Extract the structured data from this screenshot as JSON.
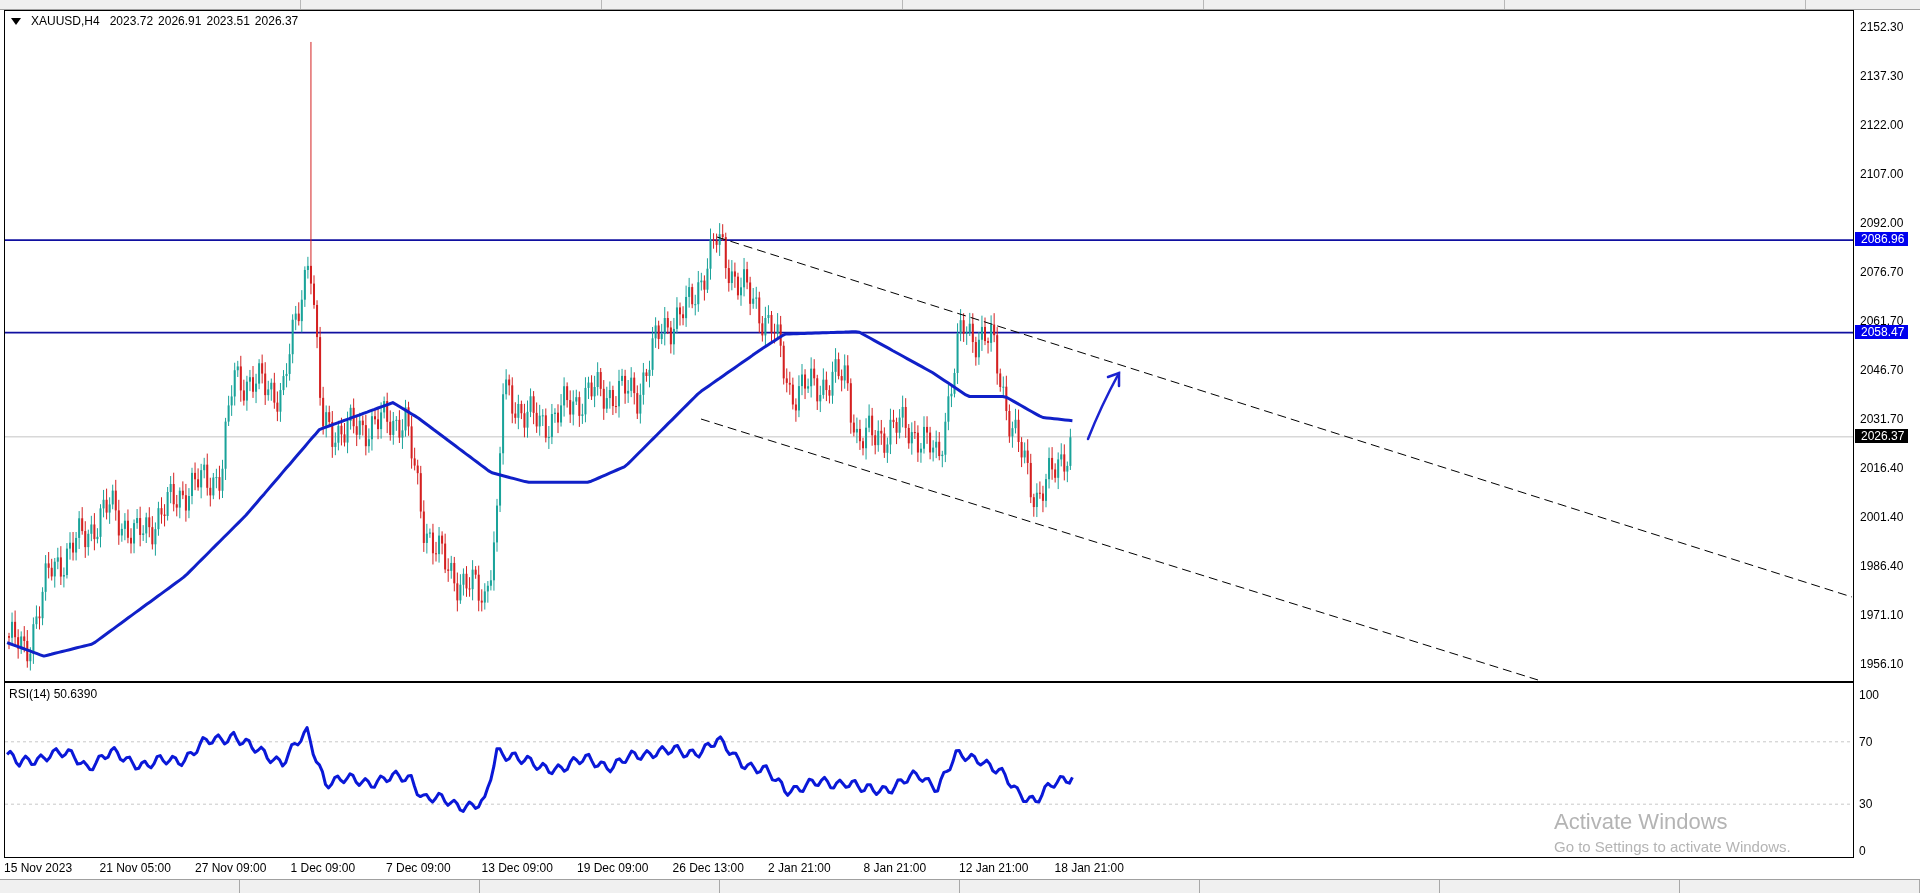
{
  "chart": {
    "symbol": "XAUUSD,H4",
    "ohlc": [
      "2023.72",
      "2026.91",
      "2023.51",
      "2026.37"
    ],
    "price_axis": [
      "2152.30",
      "2137.30",
      "2122.00",
      "2107.00",
      "2092.00",
      "2076.70",
      "2061.70",
      "2046.70",
      "2031.70",
      "2016.40",
      "2001.40",
      "1986.40",
      "1971.10",
      "1956.10"
    ],
    "price_tags": [
      {
        "label": "2086.96",
        "kind": "level"
      },
      {
        "label": "2058.47",
        "kind": "level"
      },
      {
        "label": "2026.37",
        "kind": "bid"
      }
    ],
    "rsi": {
      "label": "RSI(14) 50.6390",
      "axis": [
        "100",
        "70",
        "30",
        "0"
      ]
    },
    "time_axis": [
      "15 Nov 2023",
      "21 Nov 05:00",
      "27 Nov 09:00",
      "1 Dec 09:00",
      "7 Dec 09:00",
      "13 Dec 09:00",
      "19 Dec 09:00",
      "26 Dec 13:00",
      "2 Jan 21:00",
      "8 Jan 21:00",
      "12 Jan 21:00",
      "18 Jan 21:00"
    ]
  },
  "os_notice": {
    "title": "Activate Windows",
    "subtitle": "Go to Settings to activate Windows."
  }
}
